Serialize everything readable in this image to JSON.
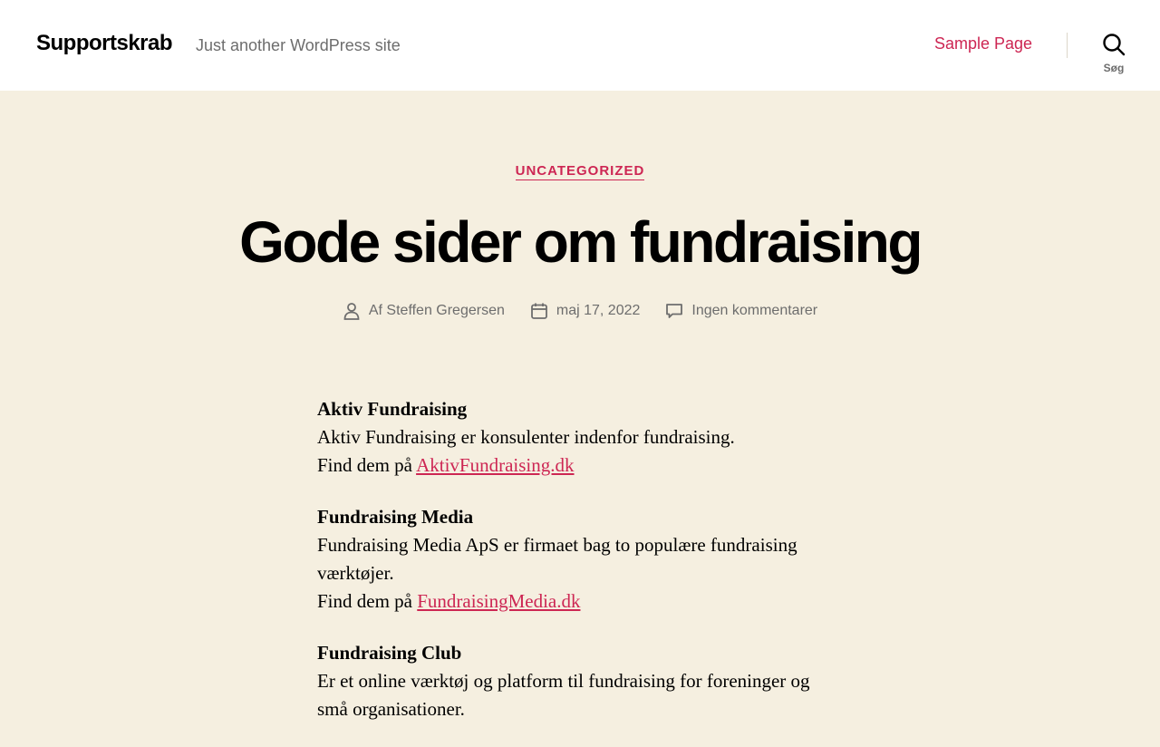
{
  "header": {
    "site_title": "Supportskrab",
    "site_description": "Just another WordPress site",
    "nav_items": [
      {
        "label": "Sample Page"
      }
    ],
    "search_label": "Søg"
  },
  "post": {
    "category": "UNCATEGORIZED",
    "title": "Gode sider om fundraising",
    "author": "Af Steffen Gregersen",
    "date": "maj 17, 2022",
    "comments": "Ingen kommentarer",
    "sections": [
      {
        "heading": "Aktiv Fundraising",
        "text": "Aktiv Fundraising er konsulenter indenfor fundraising.",
        "find_prefix": "Find dem på ",
        "link": "AktivFundraising.dk"
      },
      {
        "heading": "Fundraising Media",
        "text": "Fundraising Media ApS er firmaet bag to populære fundraising værktøjer.",
        "find_prefix": "Find dem på ",
        "link": "FundraisingMedia.dk"
      },
      {
        "heading": "Fundraising Club",
        "text": "Er et online værktøj og platform til fundraising for foreninger og små organisationer."
      }
    ]
  },
  "colors": {
    "accent": "#cd2653",
    "background": "#f5efe0",
    "header_bg": "#ffffff",
    "secondary_text": "#6d6d6d"
  },
  "icons": [
    "search-icon",
    "user-icon",
    "calendar-icon",
    "comment-icon"
  ]
}
